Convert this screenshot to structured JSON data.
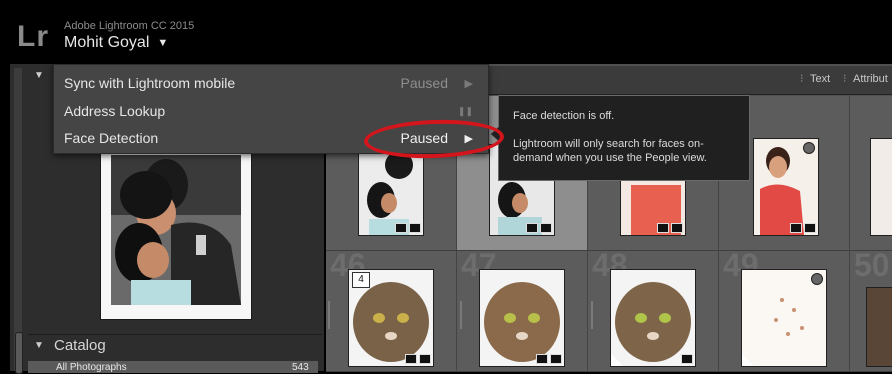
{
  "app": {
    "logo": "Lr",
    "product_name": "Adobe Lightroom CC 2015",
    "user_name": "Mohit Goyal"
  },
  "left_panel": {
    "catalog": {
      "label": "Catalog",
      "row_label": "All Photographs",
      "row_count": "543"
    }
  },
  "filter_bar": {
    "text_label": "Text",
    "attribute_label": "Attribut",
    "separator": "⁝"
  },
  "grid": {
    "cells": [
      {
        "number": "",
        "selected": false
      },
      {
        "number": "",
        "selected": true
      },
      {
        "number": "",
        "selected": false
      },
      {
        "number": "",
        "selected": false
      },
      {
        "number": "46",
        "selected": false
      },
      {
        "number": "47",
        "selected": false
      },
      {
        "number": "48",
        "selected": false
      },
      {
        "number": "49",
        "selected": false
      },
      {
        "number": "50",
        "selected": false
      }
    ],
    "stack_count": "4"
  },
  "menu": {
    "items": [
      {
        "label": "Sync with Lightroom mobile",
        "status": "Paused",
        "icon": "play-icon",
        "glyph": "▶",
        "enabled": false
      },
      {
        "label": "Address Lookup",
        "status": "",
        "icon": "pause-icon",
        "glyph": "❚❚",
        "enabled": false
      },
      {
        "label": "Face Detection",
        "status": "Paused",
        "icon": "play-icon",
        "glyph": "▶",
        "enabled": true
      }
    ]
  },
  "tooltip": {
    "line1": "Face detection is off.",
    "line2": "Lightroom will only search for faces on-demand when you use the People view."
  },
  "colors": {
    "annotation": "#d4161c",
    "menu_bg": "#454545",
    "panel_bg": "#2d2d2d",
    "grid_bg": "#505050"
  }
}
